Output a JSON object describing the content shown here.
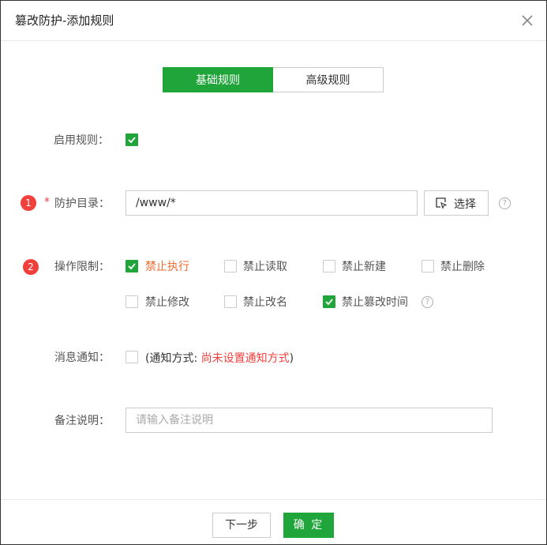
{
  "dialog": {
    "title": "篡改防护-添加规则",
    "close_icon": "close-icon"
  },
  "tabs": [
    {
      "label": "基础规则",
      "active": true
    },
    {
      "label": "高级规则",
      "active": false
    }
  ],
  "enable_rule": {
    "label": "启用规则：",
    "checked": true
  },
  "protect_dir": {
    "badge": "1",
    "required_mark": "*",
    "label": "防护目录：",
    "value": "/www/*",
    "select_label": "选择",
    "select_icon": "folder-select-icon",
    "help_icon": "question-circle-icon"
  },
  "operation_limits": {
    "badge": "2",
    "label": "操作限制：",
    "options": [
      {
        "label": "禁止执行",
        "checked": true,
        "highlight": true
      },
      {
        "label": "禁止读取",
        "checked": false
      },
      {
        "label": "禁止新建",
        "checked": false
      },
      {
        "label": "禁止删除",
        "checked": false
      },
      {
        "label": "禁止修改",
        "checked": false
      },
      {
        "label": "禁止改名",
        "checked": false
      },
      {
        "label": "禁止篡改时间",
        "checked": true
      }
    ],
    "help_icon": "question-circle-icon"
  },
  "notification": {
    "label": "消息通知：",
    "checked": false,
    "prefix": "(通知方式: ",
    "status": "尚未设置通知方式",
    "suffix": ")"
  },
  "remark": {
    "label": "备注说明：",
    "placeholder": "请输入备注说明",
    "value": ""
  },
  "footer": {
    "next_label": "下一步",
    "confirm_label": "确 定"
  },
  "colors": {
    "accent": "#20a53a",
    "danger": "#f0403c",
    "highlight": "#ef6a2c"
  }
}
